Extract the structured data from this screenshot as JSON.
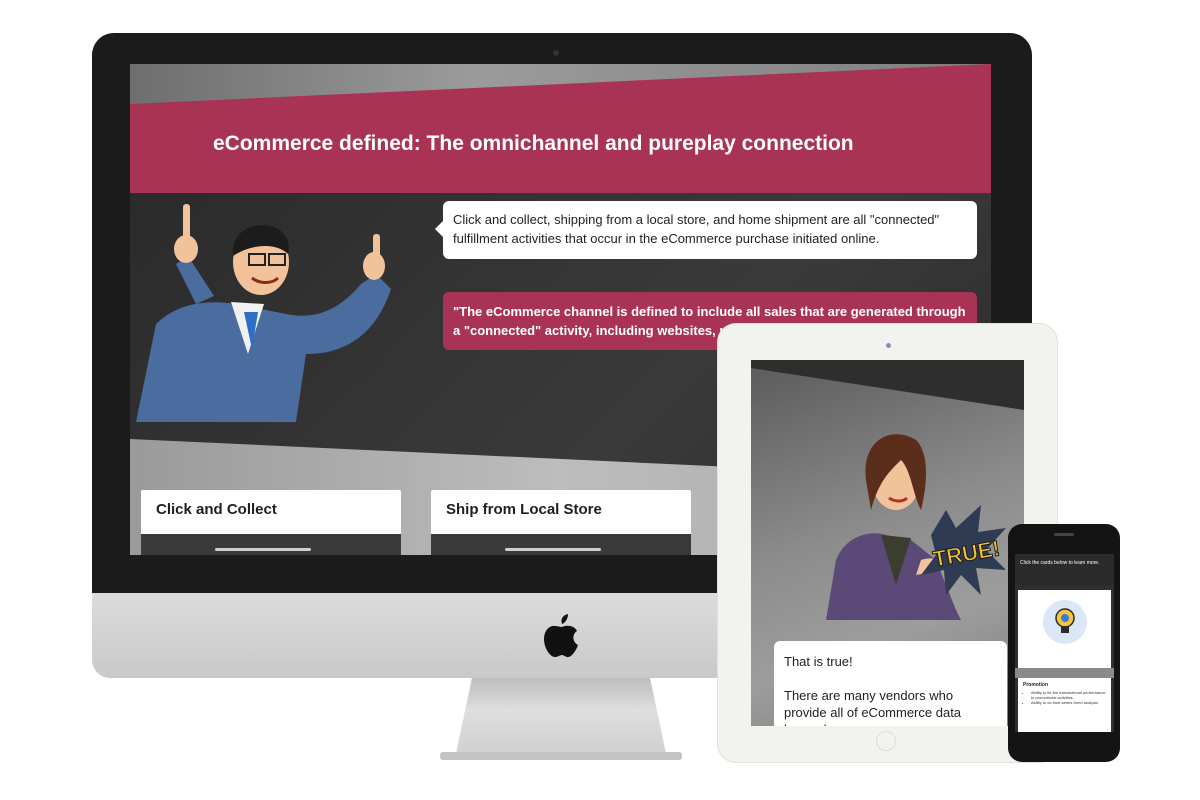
{
  "desktop": {
    "title": "eCommerce defined: The omnichannel and pureplay connection",
    "bubble_info": "Click and collect, shipping from a local store, and home shipment are all \"connected\" fulfillment activities that occur in the eCommerce purchase initiated online.",
    "bubble_quote": "\"The eCommerce channel is defined to include all sales that are generated through a \"connected\" activity, including websites, mobil",
    "cards": [
      {
        "label": "Click and Collect"
      },
      {
        "label": "Ship from Local Store"
      }
    ]
  },
  "tablet": {
    "badge_text": "TRUE!",
    "bubble_line1": "That is true!",
    "bubble_line2": "There are many vendors who provide all of eCommerce data beyond"
  },
  "phone": {
    "header": "Click the cards below to learn more.",
    "card_title": "Promotion",
    "bullets": [
      "Ability to tie the transactional performance to promotional activities",
      "Ability to do time-series trend analysis"
    ]
  },
  "colors": {
    "accent": "#a93355",
    "dark_bg": "#2b2b2b",
    "card_bg": "#ffffff"
  }
}
